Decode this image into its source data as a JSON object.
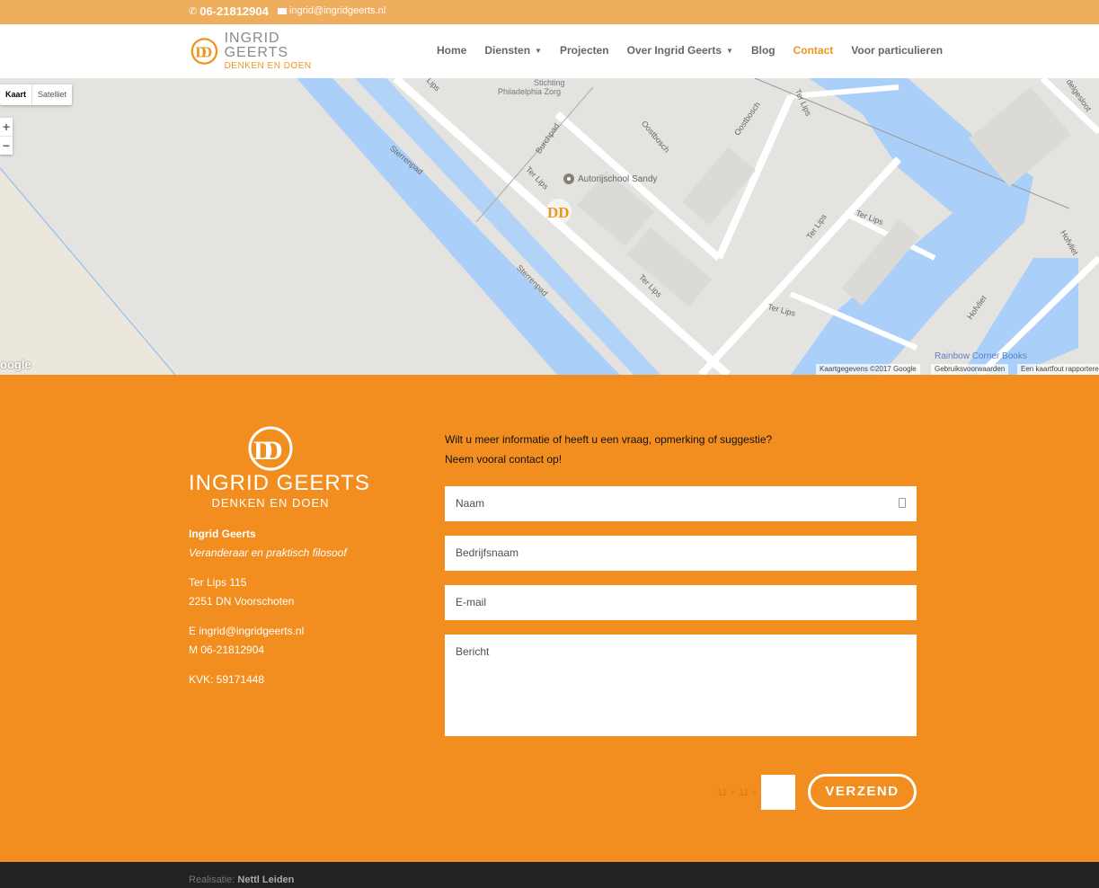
{
  "topbar": {
    "phone": "06-21812904",
    "email": "ingrid@ingridgeerts.nl"
  },
  "header": {
    "logo_line1": "INGRID GEERTS",
    "logo_line2": "DENKEN EN DOEN",
    "nav": [
      {
        "label": "Home"
      },
      {
        "label": "Diensten"
      },
      {
        "label": "Projecten"
      },
      {
        "label": "Over Ingrid Geerts"
      },
      {
        "label": "Blog"
      },
      {
        "label": "Contact"
      },
      {
        "label": "Voor particulieren"
      }
    ]
  },
  "map": {
    "type_map": "Kaart",
    "type_satellite": "Satelliet",
    "zoom_in": "+",
    "zoom_out": "−",
    "google": "oogle",
    "attribution": "Kaartgegevens ©2017 Google",
    "terms": "Gebruiksvoorwaarden",
    "report": "Een kaartfout rapporteren",
    "labels": {
      "stichting1": "Stichting",
      "stichting2": "Philadelphia Zorg",
      "autorijschool": "Autorijschool Sandy",
      "rainbow": "Rainbow Corner Books",
      "lips_top": "Lips",
      "burchpad": "Burchpad",
      "oostbosch1": "Oostbosch",
      "oostbosch2": "Oostbosch",
      "terlips_top": "Ter Lips",
      "delgesloot": "delgesloot",
      "sterrenpad1": "Sterrenpad",
      "terlips1": "Ter Lips",
      "terlips2": "Ter Lips",
      "terlips3": "Ter Lips",
      "terlips4": "Ter Lips",
      "terlips5": "Ter Lips",
      "hofvliet1": "Hofvliet",
      "hofvliet2": "Hofvliet",
      "sterrenpad2": "Sterrenpad"
    }
  },
  "contact": {
    "logo_line1": "INGRID GEERTS",
    "logo_line2": "DENKEN EN DOEN",
    "name": "Ingrid Geerts",
    "tagline": "Veranderaar en praktisch filosoof",
    "address1": "Ter Lips 115",
    "address2": "2251 DN Voorschoten",
    "email_line": "E ingrid@ingridgeerts.nl",
    "mobile_line": "M 06-21812904",
    "kvk": "KVK: 59171448",
    "intro1": "Wilt u meer informatie of heeft u een vraag, opmerking of suggestie?",
    "intro2": "Neem vooral contact op!",
    "fields": {
      "name": "Naam",
      "company": "Bedrijfsnaam",
      "email": "E-mail",
      "message": "Bericht"
    },
    "captcha": "11 + 11 =",
    "submit": "VERZEND"
  },
  "footer": {
    "prefix": "Realisatie:",
    "credit": "Nettl Leiden"
  },
  "colors": {
    "topbar": "#efae5e",
    "orange": "#f28e1f",
    "water": "#a9cdf8",
    "footer": "#222222"
  }
}
